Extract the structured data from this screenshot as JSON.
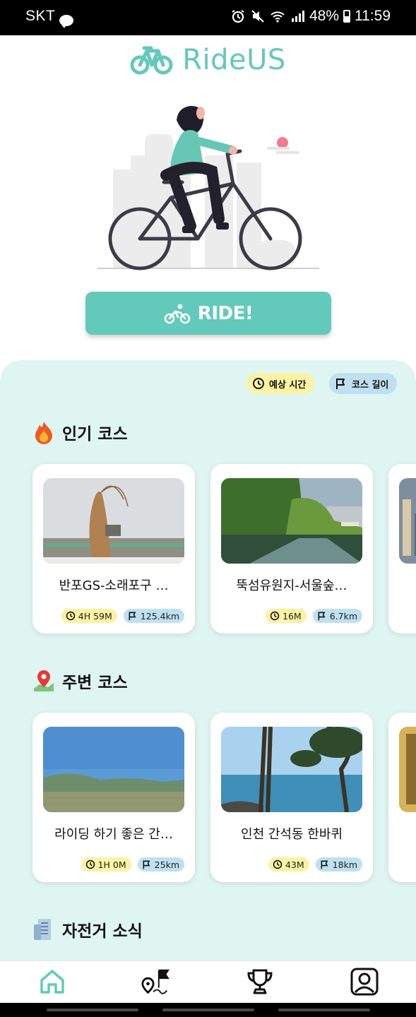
{
  "status_bar": {
    "carrier": "SKT",
    "chat_badge": "TALK",
    "battery": "48%",
    "time": "11:59"
  },
  "app": {
    "name": "RideUS",
    "ride_button_label": "RIDE!"
  },
  "legend": {
    "time_label": "예상 시간",
    "length_label": "코스 길이"
  },
  "sections": {
    "popular": {
      "title": "인기 코스",
      "cards": [
        {
          "name": "반포GS-소래포구 …",
          "time": "4H 59M",
          "length": "125.4km"
        },
        {
          "name": "뚝섬유원지-서울숲…",
          "time": "16M",
          "length": "6.7km"
        }
      ]
    },
    "nearby": {
      "title": "주변 코스",
      "cards": [
        {
          "name": "라이딩 하기 좋은 간…",
          "time": "1H 0M",
          "length": "25km"
        },
        {
          "name": "인천 간석동 한바퀴",
          "time": "43M",
          "length": "18km"
        }
      ]
    },
    "news": {
      "title": "자전거 소식"
    }
  },
  "bottom_nav": {
    "items": [
      "home-icon",
      "course-map-icon",
      "trophy-icon",
      "profile-icon"
    ],
    "active": "home-icon"
  },
  "colors": {
    "brand": "#63c9bb",
    "panel_bg": "#dff5f1",
    "time_badge": "#fbf3a3",
    "length_badge": "#bfe0f0"
  }
}
